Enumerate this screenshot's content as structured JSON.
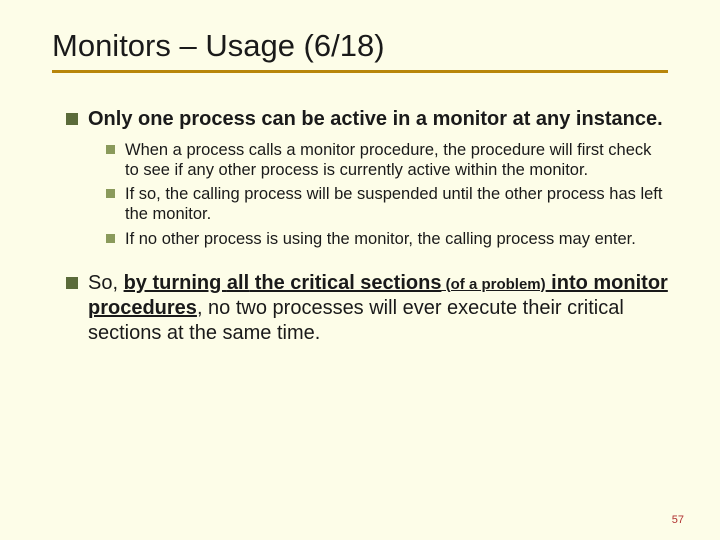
{
  "title": "Monitors – Usage (6/18)",
  "bullets": {
    "b1": "Only one process can be active in a monitor at any instance.",
    "sub": {
      "s1": "When a process calls a monitor procedure, the procedure will first check to see if any other process is currently active within the monitor.",
      "s2": "If so, the calling process will be suspended until the other process has left the monitor.",
      "s3": "If no other process is using the monitor, the calling process may enter."
    },
    "b2": {
      "pre": "So, ",
      "phrase1": "by turning ",
      "all": "all",
      "phrase2": " the critical sections",
      "paren": " (of a problem)",
      "phrase3": " into monitor procedures",
      "rest": ", no two processes will ever execute their critical sections at the same time."
    }
  },
  "pagenum": "57"
}
